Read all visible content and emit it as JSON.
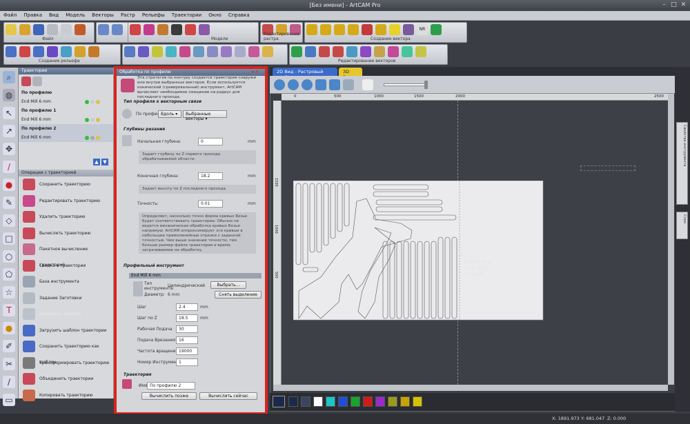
{
  "window": {
    "title": "[Без имени] - ArtCAM Pro"
  },
  "menu": [
    "Файл",
    "Правка",
    "Вид",
    "Модель",
    "Векторы",
    "Растр",
    "Рельефы",
    "Траектории",
    "Окно",
    "Справка"
  ],
  "toolbars": {
    "file_group": "Файл",
    "models_group": "Модели",
    "raster_edit_group": "Редактирование растра",
    "vector_create_group": "Создание вектора",
    "relief_create_group": "Создание рельефа",
    "vector_edit_group": "Редактирование векторов",
    "nr_label": "NR"
  },
  "toolpaths_panel": {
    "header": "Траектории",
    "items": [
      {
        "name": "По профилю",
        "tool": "End Mill 6 mm"
      },
      {
        "name": "По профилю 1",
        "tool": "End Mill 6 mm"
      },
      {
        "name": "По профилю 2",
        "tool": "End Mill 6 mm"
      }
    ],
    "ops_header": "Операции с траекторией",
    "ops": [
      "Сохранить траекторию",
      "Редактировать траекторию",
      "Удалить траекторию",
      "Вычислить траекторию",
      "Пакетное вычисление траекторий",
      "Сводка о траектории",
      "База инструмента",
      "Задание Заготовки",
      "Сохранить шаблон",
      "Загрузить шаблон траектории",
      "Сохранить траекторию как шаблон",
      "Трансформировать траекторию",
      "Объединить траектории",
      "Копировать траекторию"
    ]
  },
  "dialog": {
    "title": "Обработка по профилю",
    "intro": "Эта стратегия по контуру создается траектория снаружи или внутри выбранных векторов. Если используется конический (гравировальный) инструмент, ArtCAM вычисляет необходимое смещение на радиус для последнего прохода.",
    "profile_type_title": "Тип профиля к векторным связи",
    "profile_label": "По профилю",
    "profile_value": "Вдоль",
    "vectors_value": "Выбранные векторы",
    "cut_depths_title": "Глубины резания",
    "start_depth_label": "Начальная глубина:",
    "start_depth_value": "0",
    "start_depth_desc": "Задает глубину по Z первого прохода обрабатываемой области.",
    "end_depth_label": "Конечная глубина:",
    "end_depth_value": "18.2",
    "end_depth_desc": "Задает высоту по Z последнего прохода.",
    "unit_mm": "mm",
    "tolerance_label": "Точность:",
    "tolerance_value": "0.01",
    "tolerance_desc": "Определяет, насколько точно форма кривых Безье будет соответствовать траектории. Обычно не ведется механическая обработка кривых Безье напрямую. ArtCAM аппроксимирует эти кривые в небольшие прямолинейные отрезки с заданной точностью. Чем выше значение точности, тем больше размер файла траектории и время, затрачиваемое на обработку.",
    "tool_title": "Профильный инструмент",
    "tool_name": "End Mill 6 mm",
    "tool_type_label": "Тип инструмента:",
    "tool_type_value": "Цилиндрический",
    "diameter_label": "Диаметр:",
    "diameter_value": "6 mm",
    "select_button": "Выбрать...",
    "clear_button": "Снять выделение",
    "params": [
      {
        "label": "Шаг",
        "value": "2.4",
        "unit": "mm"
      },
      {
        "label": "Шаг по Z",
        "value": "18.5",
        "unit": "mm"
      },
      {
        "label": "Рабочая Подача",
        "value": "30",
        "unit": ""
      },
      {
        "label": "Подача Врезания",
        "value": "16",
        "unit": ""
      },
      {
        "label": "Частота вращения",
        "value": "19000",
        "unit": ""
      },
      {
        "label": "Номер Инструмента",
        "value": "1",
        "unit": ""
      }
    ],
    "toolpath_title": "Траектория",
    "name_label": "Имя:",
    "name_value": "По профилю 2",
    "later_button": "Вычислить позже",
    "now_button": "Вычислить сейчас"
  },
  "view": {
    "tab_2d": "2D Вид - Растровый слой",
    "tab_3d": "3D Вид",
    "ruler_marks": [
      "0",
      "500",
      "1000",
      "1500",
      "2000",
      "2500"
    ],
    "ruler_v_marks": [
      "1500",
      "1000",
      "500"
    ],
    "cursor_x": "X: 1891.9731",
    "cursor_y": "Y: 681.0467",
    "cursor_z": "Z: 0.0000"
  },
  "right_tabs": [
    "Свойства инструмента",
    "Слои"
  ],
  "palette_colors": [
    "#1b2a4a",
    "#3a4560",
    "#ffffff",
    "#1ac6c6",
    "#1e4fd6",
    "#17a52b",
    "#d11a1a",
    "#9a2bc7",
    "#9a9a22",
    "#c8a200",
    "#d8c200"
  ],
  "status": {
    "x": "X: 1891.973",
    "y": "Y: 681.047",
    "z": "Z: 0.000"
  }
}
